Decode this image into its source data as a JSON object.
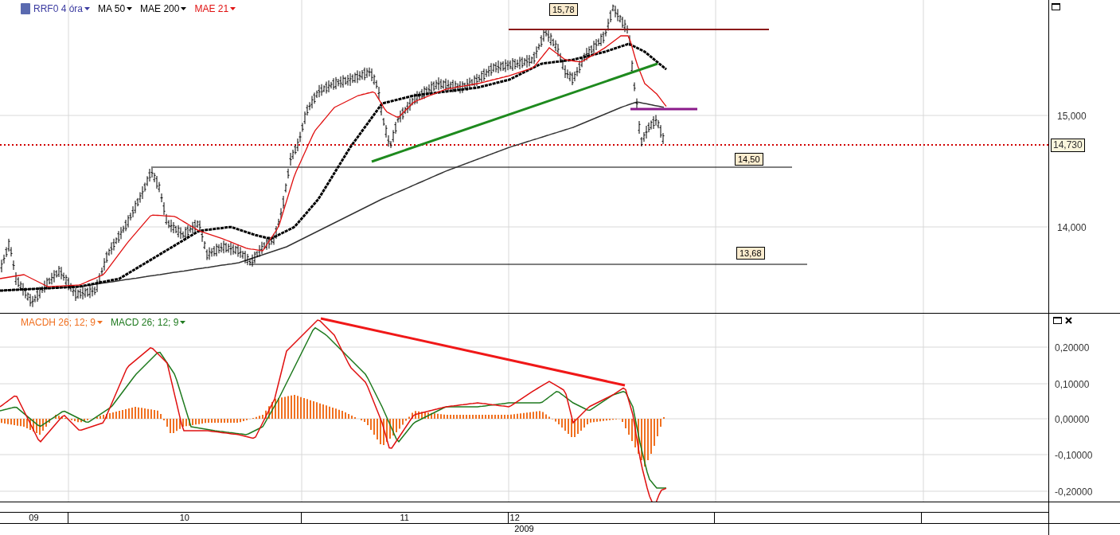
{
  "price_panel": {
    "legend": [
      {
        "label": "RRF0 4 óra",
        "color": "#3a3aa0"
      },
      {
        "label": "MA 50",
        "color": "#000000"
      },
      {
        "label": "MAE 200",
        "color": "#000000"
      },
      {
        "label": "MAE 21",
        "color": "#e01010"
      }
    ],
    "level_labels": [
      "15,78",
      "14,50",
      "13,68"
    ],
    "y_axis": [
      "15,000",
      "14,000"
    ],
    "last_price": "14,730"
  },
  "macd_panel": {
    "legend": [
      {
        "label": "MACDH 26; 12; 9",
        "color": "#f07020"
      },
      {
        "label": "MACD 26; 12; 9",
        "color": "#1f7a1f"
      }
    ],
    "y_axis": [
      "0,20000",
      "0,10000",
      "0,00000",
      "-0,10000",
      "-0,20000"
    ]
  },
  "x_axis": {
    "months": [
      "09",
      "10",
      "11",
      "12"
    ],
    "year": "2009"
  }
}
